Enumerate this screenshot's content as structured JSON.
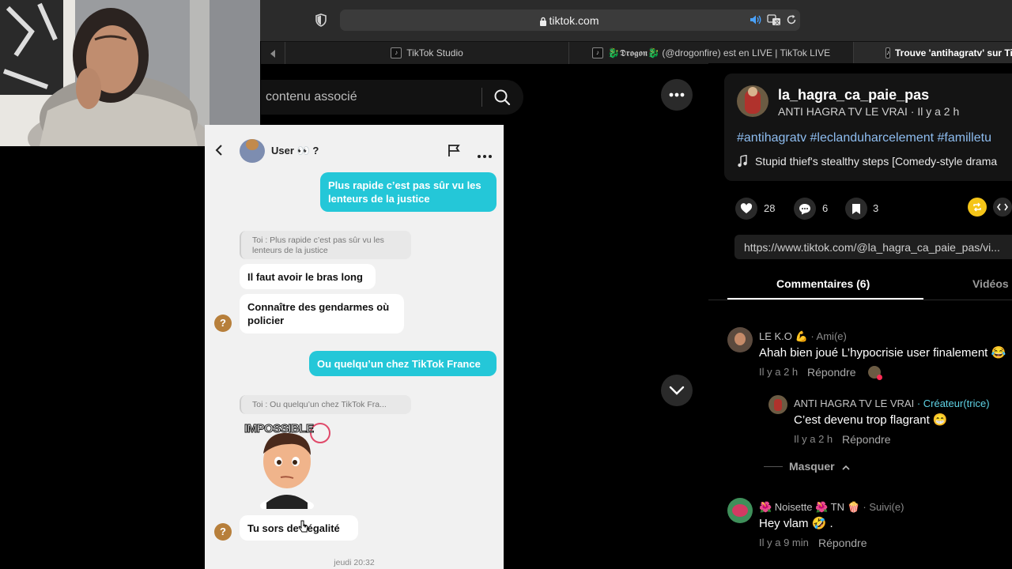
{
  "browser": {
    "url": "tiktok.com",
    "tabs": [
      {
        "label": "TikTok Studio"
      },
      {
        "label": "🐉𝕯𝖗𝖔𝖌𝖔𝖓🐉 (@drogonfire) est en LIVE | TikTok LIVE"
      },
      {
        "label": "Trouve 'antihagratv' sur TikTok"
      }
    ]
  },
  "search": {
    "placeholder": "contenu associé"
  },
  "video": {
    "header_name": "User 👀 ?",
    "messages": {
      "out1": "Plus rapide c’est pas sûr vu les lenteurs de la justice",
      "quote1": "Toi : Plus rapide c’est pas sûr vu les lenteurs de la justice",
      "in1": "Il faut avoir le bras long",
      "in2": "Connaître des gendarmes où policier",
      "out2": "Ou quelqu’un chez TikTok France",
      "quote2": "Toi : Ou quelqu’un chez TikTok Fra...",
      "sticker": "IMPOSSIBLE",
      "in3": "Tu sors de l’égalité",
      "timestamp": "jeudi 20:32"
    }
  },
  "post": {
    "username": "la_hagra_ca_paie_pas",
    "display": "ANTI HAGRA TV LE VRAI · Il y a 2 h",
    "hashtags": "#antihagratv #leclanduharcelement #familletu",
    "music": "Stupid thief's stealthy steps [Comedy-style drama",
    "likes": "28",
    "comments": "6",
    "saves": "3",
    "link": "https://www.tiktok.com/@la_hagra_ca_paie_pas/vi..."
  },
  "tabs": {
    "comments": "Commentaires (6)",
    "videos": "Vidéos c"
  },
  "comments": [
    {
      "name": "LE K.O 💪",
      "tag": " · Ami(e)",
      "text": "Ahah bien joué L’hypocrisie user finalement 😂",
      "time": "Il y a 2 h",
      "reply": "Répondre"
    },
    {
      "name": "ANTI HAGRA TV LE VRAI",
      "tag": " · Créateur(trice)",
      "text": "C’est devenu trop flagrant 😁",
      "time": "Il y a 2 h",
      "reply": "Répondre"
    },
    {
      "name": "🌺 Noisette 🌺 TN 🍿",
      "tag": " · Suivi(e)",
      "text": "Hey vlam 🤣 .",
      "time": "Il y a 9 min",
      "reply": "Répondre"
    }
  ],
  "hide_label": "Masquer",
  "colors": {
    "accent_cyan": "#24c7d8",
    "creator_label": "#5fd3e6",
    "hashtag": "#8ebdf0"
  }
}
